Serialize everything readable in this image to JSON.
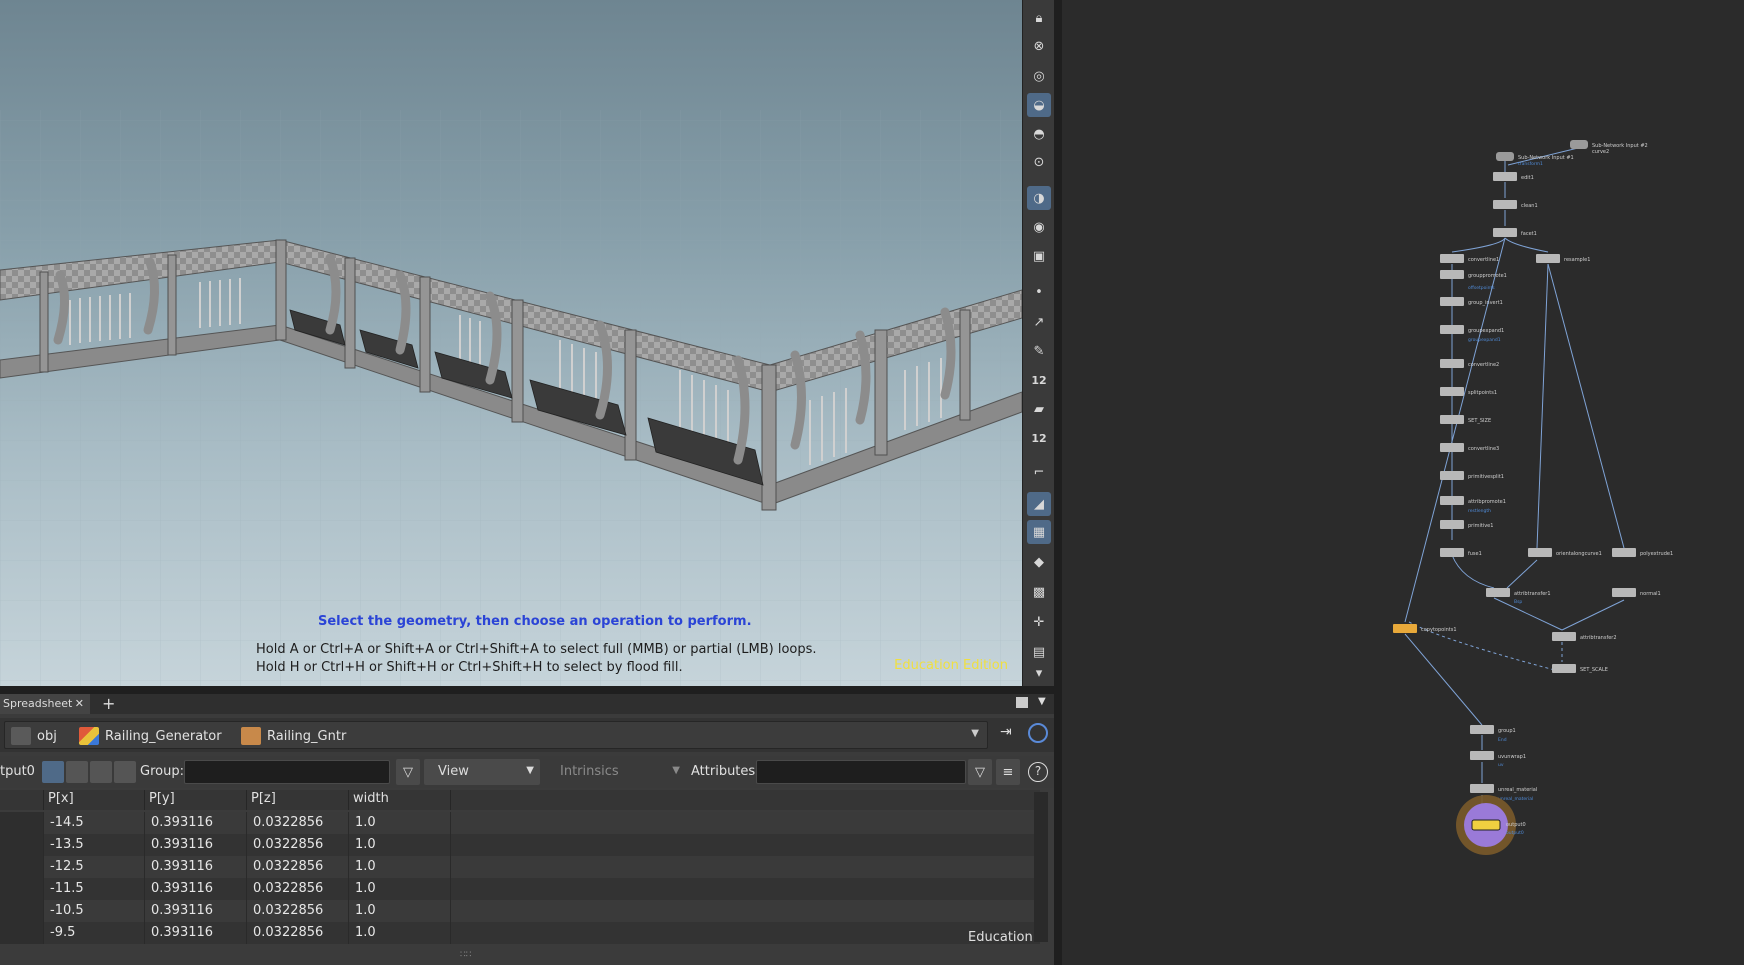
{
  "viewport": {
    "primary_message": "Select the geometry, then choose an operation to perform.",
    "hint_line_1": "Hold A or Ctrl+A or Shift+A or Ctrl+Shift+A to select full (MMB) or partial (LMB) loops.",
    "hint_line_2": "Hold H or Ctrl+H or Shift+H or Ctrl+Shift+H to select by flood fill.",
    "edition": "Education Edition"
  },
  "toolbar": {
    "icons": [
      "lock-icon",
      "close-circle-icon",
      "display-options-icon",
      "light-bulb-icon",
      "light-bulb-icon",
      "headlight-icon",
      "shading-icon",
      "visibility-icon",
      "camera-icon",
      "point-icon",
      "normal-icon",
      "pen-icon",
      "point-numbers-icon",
      "paint-icon",
      "prim-numbers-icon",
      "curve-icon",
      "template-icon",
      "texture-icon",
      "snap-icon",
      "map-icon",
      "transform-icon",
      "menu-icon",
      "more-down-icon"
    ],
    "point_numbers_label": "12",
    "prim_numbers_label": "12"
  },
  "spreadsheet": {
    "tab_label": "Spreadsheet",
    "path": {
      "obj": "obj",
      "asset": "Railing_Generator",
      "node": "Railing_Gntr"
    },
    "node_label": "tput0",
    "group_label": "Group:",
    "group_value": "",
    "view_label": "View",
    "intrinsics_label": "Intrinsics",
    "attributes_label": "Attributes:",
    "attributes_value": "",
    "columns": [
      "P[x]",
      "P[y]",
      "P[z]",
      "width"
    ],
    "rows": [
      [
        "-14.5",
        "0.393116",
        "0.0322856",
        "1.0"
      ],
      [
        "-13.5",
        "0.393116",
        "0.0322856",
        "1.0"
      ],
      [
        "-12.5",
        "0.393116",
        "0.0322856",
        "1.0"
      ],
      [
        "-11.5",
        "0.393116",
        "0.0322856",
        "1.0"
      ],
      [
        "-10.5",
        "0.393116",
        "0.0322856",
        "1.0"
      ],
      [
        "-9.5",
        "0.393116",
        "0.0322856",
        "1.0"
      ]
    ],
    "edition": "Education"
  },
  "network": {
    "nodes": [
      {
        "label": "Sub-Network Input #1",
        "sub": "transform1"
      },
      {
        "label": "Sub-Network Input #2",
        "sub": "curve2"
      },
      {
        "label": "edit1",
        "sub": ""
      },
      {
        "label": "clean1",
        "sub": ""
      },
      {
        "label": "facet1",
        "sub": ""
      },
      {
        "label": "convertline1",
        "sub": ""
      },
      {
        "label": "resample1",
        "sub": ""
      },
      {
        "label": "grouppromote1",
        "sub": "offsetpoints"
      },
      {
        "label": "group_invert1",
        "sub": ""
      },
      {
        "label": "groupexpand1",
        "sub": "groupexpand1"
      },
      {
        "label": "convertline2",
        "sub": ""
      },
      {
        "label": "splitpoints1",
        "sub": ""
      },
      {
        "label": "SET_SIZE",
        "sub": ""
      },
      {
        "label": "convertline3",
        "sub": ""
      },
      {
        "label": "primitivesplit1",
        "sub": ""
      },
      {
        "label": "attribpromote1",
        "sub": "restlength"
      },
      {
        "label": "primitive1",
        "sub": ""
      },
      {
        "label": "fuse1",
        "sub": ""
      },
      {
        "label": "orientalongcurve1",
        "sub": ""
      },
      {
        "label": "polyextrude1",
        "sub": ""
      },
      {
        "label": "attribtransfer1",
        "sub": "Bsp"
      },
      {
        "label": "normal1",
        "sub": ""
      },
      {
        "label": "copytopoints1",
        "sub": ""
      },
      {
        "label": "attribtransfer2",
        "sub": ""
      },
      {
        "label": "SET_SCALE",
        "sub": ""
      },
      {
        "label": "group1",
        "sub": "End"
      },
      {
        "label": "uvunwrap1",
        "sub": "uv"
      },
      {
        "label": "unreal_material",
        "sub": "unreal_material"
      },
      {
        "label": "output0",
        "sub": "output0"
      }
    ]
  }
}
